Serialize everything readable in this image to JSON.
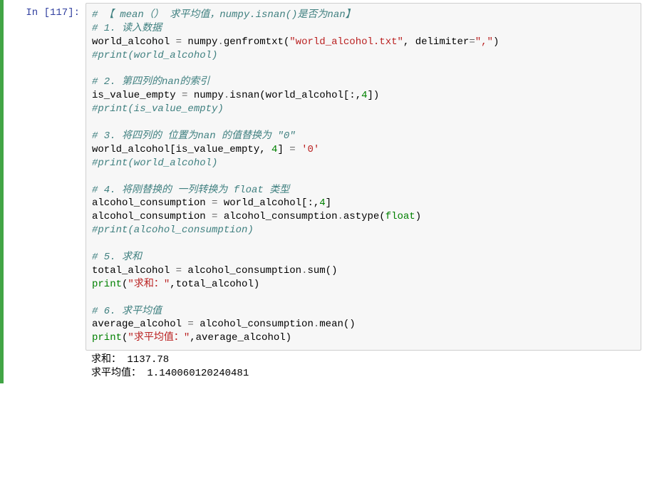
{
  "cell": {
    "prompt_prefix": "In  [",
    "exec_count": "117",
    "prompt_suffix": "]:",
    "code": {
      "l1_comment": "# 【 mean（） 求平均值，numpy.isnan()是否为nan】",
      "l2_comment": "# 1. 读入数据",
      "l3_a": "world_alcohol ",
      "l3_op1": "=",
      "l3_b": " numpy",
      "l3_dot": ".",
      "l3_c": "genfromtxt(",
      "l3_str1": "\"world_alcohol.txt\"",
      "l3_d": ", delimiter",
      "l3_op2": "=",
      "l3_str2": "\",\"",
      "l3_e": ")",
      "l4_comment": "#print(world_alcohol)",
      "l6_comment": "# 2. 第四列的nan的索引",
      "l7_a": "is_value_empty ",
      "l7_op": "=",
      "l7_b": " numpy",
      "l7_dot": ".",
      "l7_c": "isnan(world_alcohol[:,",
      "l7_num": "4",
      "l7_d": "])",
      "l8_comment": "#print(is_value_empty)",
      "l10_comment": "# 3. 将四列的 位置为nan 的值替换为 \"0\"",
      "l11_a": "world_alcohol[is_value_empty, ",
      "l11_num": "4",
      "l11_b": "] ",
      "l11_op": "=",
      "l11_c": " ",
      "l11_str": "'0'",
      "l12_comment": "#print(world_alcohol)",
      "l14_comment": "# 4. 将刚替换的 一列转换为 float 类型",
      "l15_a": "alcohol_consumption ",
      "l15_op": "=",
      "l15_b": " world_alcohol[:,",
      "l15_num": "4",
      "l15_c": "]",
      "l16_a": "alcohol_consumption ",
      "l16_op": "=",
      "l16_b": " alcohol_consumption",
      "l16_dot": ".",
      "l16_c": "astype(",
      "l16_builtin": "float",
      "l16_d": ")",
      "l17_comment": "#print(alcohol_consumption)",
      "l19_comment": "# 5. 求和",
      "l20_a": "total_alcohol ",
      "l20_op": "=",
      "l20_b": " alcohol_consumption",
      "l20_dot": ".",
      "l20_c": "sum()",
      "l21_print": "print",
      "l21_a": "(",
      "l21_str": "\"求和：\"",
      "l21_b": ",total_alcohol)",
      "l23_comment": "# 6. 求平均值",
      "l24_a": "average_alcohol ",
      "l24_op": "=",
      "l24_b": " alcohol_consumption",
      "l24_dot": ".",
      "l24_c": "mean()",
      "l25_print": "print",
      "l25_a": "(",
      "l25_str": "\"求平均值：\"",
      "l25_b": ",average_alcohol)"
    },
    "output": {
      "line1": "求和： 1137.78",
      "line2": "求平均值： 1.140060120240481"
    }
  }
}
